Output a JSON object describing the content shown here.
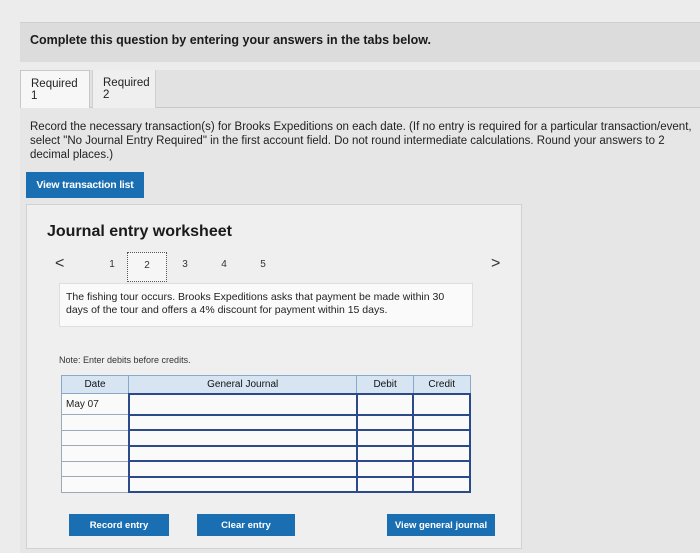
{
  "header": {
    "title": "Complete this question by entering your answers in the tabs below."
  },
  "tabs": [
    {
      "label": "Required 1",
      "active": true
    },
    {
      "label": "Required 2",
      "active": false
    }
  ],
  "instructions": "Record the necessary transaction(s) for Brooks Expeditions on each date. (If no entry is required for a particular transaction/event, select \"No Journal Entry Required\" in the first account field. Do not round intermediate calculations. Round your answers to 2 decimal places.)",
  "view_transaction_label": "View transaction list",
  "worksheet": {
    "title": "Journal entry worksheet",
    "prev_icon": "<",
    "next_icon": ">",
    "pages": [
      "1",
      "2",
      "3",
      "4",
      "5"
    ],
    "current_page": "2",
    "description": "The fishing tour occurs. Brooks Expeditions asks that payment be made within 30 days of the tour and offers a 4% discount for payment within 15 days.",
    "note": "Note: Enter debits before credits.",
    "table": {
      "headers": [
        "Date",
        "General Journal",
        "Debit",
        "Credit"
      ],
      "rows": [
        {
          "date": "May 07",
          "account": "",
          "debit": "",
          "credit": ""
        },
        {
          "date": "",
          "account": "",
          "debit": "",
          "credit": ""
        },
        {
          "date": "",
          "account": "",
          "debit": "",
          "credit": ""
        },
        {
          "date": "",
          "account": "",
          "debit": "",
          "credit": ""
        },
        {
          "date": "",
          "account": "",
          "debit": "",
          "credit": ""
        },
        {
          "date": "",
          "account": "",
          "debit": "",
          "credit": ""
        }
      ]
    },
    "record_label": "Record entry",
    "clear_label": "Clear entry",
    "view_journal_label": "View general journal"
  },
  "colors": {
    "accent": "#1a6fb2",
    "table_header": "#d7e5f3",
    "input_border": "#2a4a8a"
  }
}
